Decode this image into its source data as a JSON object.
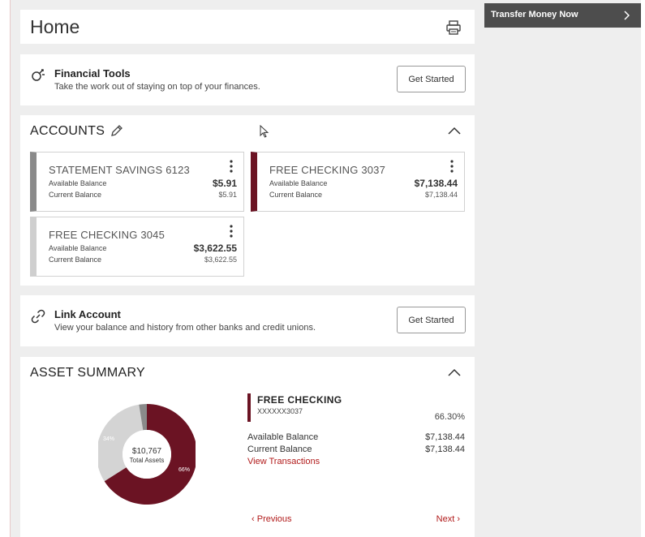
{
  "page": {
    "title": "Home",
    "print_icon": "printer-icon"
  },
  "financial_tools": {
    "title": "Financial Tools",
    "description": "Take the work out of staying on top of your finances.",
    "button": "Get Started",
    "icon": "tools-icon"
  },
  "accounts": {
    "title": "ACCOUNTS",
    "edit_icon": "pencil-icon",
    "collapse_icon": "chevron-up-icon",
    "items": [
      {
        "name": "STATEMENT SAVINGS 6123",
        "available_label": "Available Balance",
        "available": "$5.91",
        "current_label": "Current Balance",
        "current": "$5.91",
        "color": "#8a8a8a"
      },
      {
        "name": "FREE CHECKING 3037",
        "available_label": "Available Balance",
        "available": "$7,138.44",
        "current_label": "Current Balance",
        "current": "$7,138.44",
        "color": "#6b1323"
      },
      {
        "name": "FREE CHECKING 3045",
        "available_label": "Available Balance",
        "available": "$3,622.55",
        "current_label": "Current Balance",
        "current": "$3,622.55",
        "color": "#cfcfcf"
      }
    ]
  },
  "link_account": {
    "title": "Link Account",
    "description": "View your balance and history from other banks and credit unions.",
    "button": "Get Started",
    "icon": "link-icon"
  },
  "asset_summary": {
    "title": "ASSET SUMMARY",
    "total": "$10,767",
    "total_label": "Total Assets",
    "segments": [
      {
        "label": "66%",
        "percent": 66,
        "color": "#6b1323"
      },
      {
        "label": "34%",
        "percent": 31.5,
        "color": "#d4d4d4"
      },
      {
        "label": "",
        "percent": 2.5,
        "color": "#8a8a8a"
      }
    ],
    "selected": {
      "name": "FREE CHECKING",
      "number": "XXXXXX3037",
      "percent": "66.30%",
      "available_label": "Available Balance",
      "available": "$7,138.44",
      "current_label": "Current Balance",
      "current": "$7,138.44",
      "view_link": "View Transactions"
    },
    "prev_label": "Previous",
    "next_label": "Next"
  },
  "sidebar": {
    "transfer_label": "Transfer Money Now"
  },
  "colors": {
    "brand": "#6b1323",
    "link": "#b11a1a",
    "sidebar_bar": "#4d4d4d"
  }
}
